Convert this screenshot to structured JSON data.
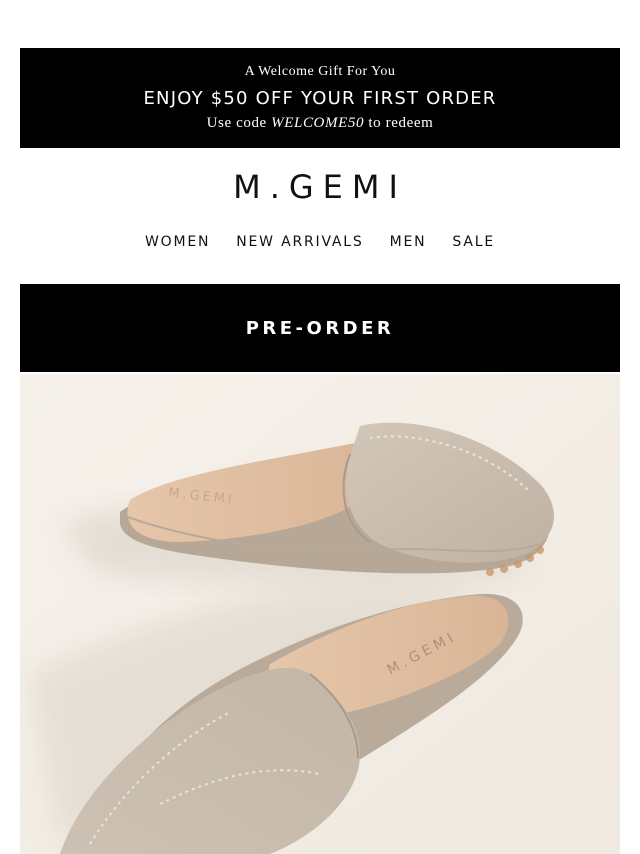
{
  "promo": {
    "eyebrow": "A Welcome Gift For You",
    "headline": "ENJOY $50 OFF YOUR FIRST ORDER",
    "code_prefix": "Use code ",
    "code": "WELCOME50",
    "code_suffix": " to redeem"
  },
  "brand": {
    "logo_text": "M.GEMI",
    "insole_stamp": "M.GEMI"
  },
  "nav": {
    "items": [
      {
        "label": "WOMEN"
      },
      {
        "label": "NEW ARRIVALS"
      },
      {
        "label": "MEN"
      },
      {
        "label": "SALE"
      }
    ]
  },
  "section": {
    "title": "PRE-ORDER"
  },
  "hero_image": {
    "icon": "product-photo-icon",
    "subject": "suede-mule-pair"
  },
  "colors": {
    "banner_bg": "#000000",
    "banner_text": "#ffffff",
    "background": "#ffffff",
    "text": "#111111",
    "suede": "#cbbfb1",
    "lining": "#e0bfa2"
  }
}
